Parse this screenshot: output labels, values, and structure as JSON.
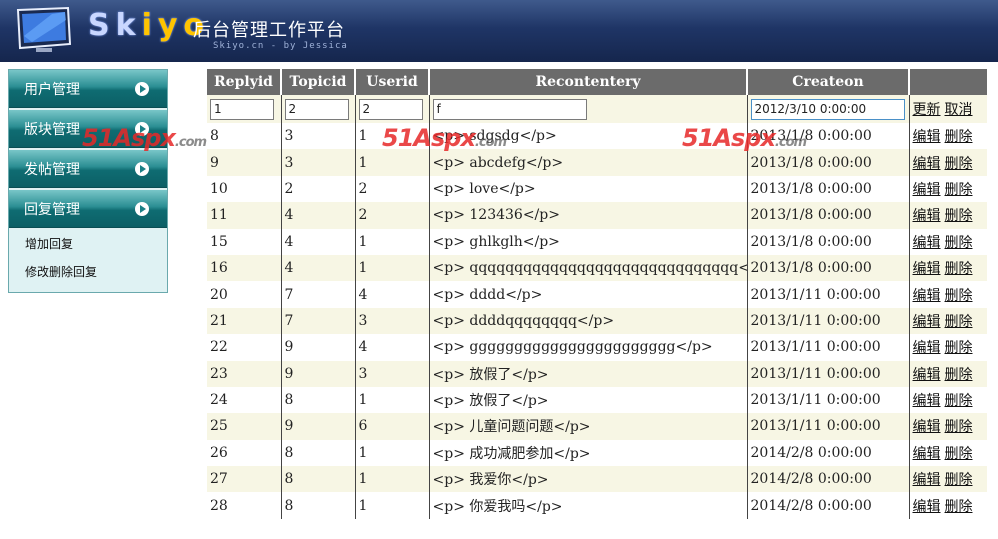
{
  "header": {
    "brand_start": "Sk",
    "brand_accent": "iyo",
    "title_cn": "后台管理工作平台",
    "subtitle": "Skiyo.cn - by Jessica"
  },
  "sidebar": {
    "menu": [
      {
        "label": "用户管理",
        "icon": "arrow-right-icon"
      },
      {
        "label": "版块管理",
        "icon": "arrow-right-icon"
      },
      {
        "label": "发帖管理",
        "icon": "arrow-right-icon"
      },
      {
        "label": "回复管理",
        "icon": "arrow-right-icon"
      }
    ],
    "submenu": [
      "增加回复",
      "修改删除回复"
    ]
  },
  "watermark": {
    "main": "51Aspx",
    "suffix": ".com"
  },
  "table": {
    "headers": [
      "Replyid",
      "Topicid",
      "Userid",
      "Recontentery",
      "Createon",
      ""
    ],
    "edit_row": {
      "replyid": "1",
      "topicid": "2",
      "userid": "2",
      "content": "f",
      "createon": "2012/3/10 0:00:00",
      "update_label": "更新",
      "cancel_label": "取消"
    },
    "action_edit": "编辑",
    "action_delete": "删除",
    "rows": [
      [
        "8",
        "3",
        "1",
        "<p> sdgsdg</p>",
        "2013/1/8 0:00:00"
      ],
      [
        "9",
        "3",
        "1",
        "<p> abcdefg</p>",
        "2013/1/8 0:00:00"
      ],
      [
        "10",
        "2",
        "2",
        "<p> love</p>",
        "2013/1/8 0:00:00"
      ],
      [
        "11",
        "4",
        "2",
        "<p> 123436</p>",
        "2013/1/8 0:00:00"
      ],
      [
        "15",
        "4",
        "1",
        "<p> ghlkglh</p>",
        "2013/1/8 0:00:00"
      ],
      [
        "16",
        "4",
        "1",
        "<p> qqqqqqqqqqqqqqqqqqqqqqqqqqqqqq</p>",
        "2013/1/8 0:00:00"
      ],
      [
        "20",
        "7",
        "4",
        "<p> dddd</p>",
        "2013/1/11 0:00:00"
      ],
      [
        "21",
        "7",
        "3",
        "<p> ddddqqqqqqqq</p>",
        "2013/1/11 0:00:00"
      ],
      [
        "22",
        "9",
        "4",
        "<p> ggggggggggggggggggggggg</p>",
        "2013/1/11 0:00:00"
      ],
      [
        "23",
        "9",
        "3",
        "<p> 放假了</p>",
        "2013/1/11 0:00:00"
      ],
      [
        "24",
        "8",
        "1",
        "<p> 放假了</p>",
        "2013/1/11 0:00:00"
      ],
      [
        "25",
        "9",
        "6",
        "<p> 儿童问题问题</p>",
        "2013/1/11 0:00:00"
      ],
      [
        "26",
        "8",
        "1",
        "<p> 成功减肥参加</p>",
        "2014/2/8 0:00:00"
      ],
      [
        "27",
        "8",
        "1",
        "<p> 我爱你</p>",
        "2014/2/8 0:00:00"
      ],
      [
        "28",
        "8",
        "1",
        "<p> 你爱我吗</p>",
        "2014/2/8 0:00:00"
      ]
    ]
  }
}
